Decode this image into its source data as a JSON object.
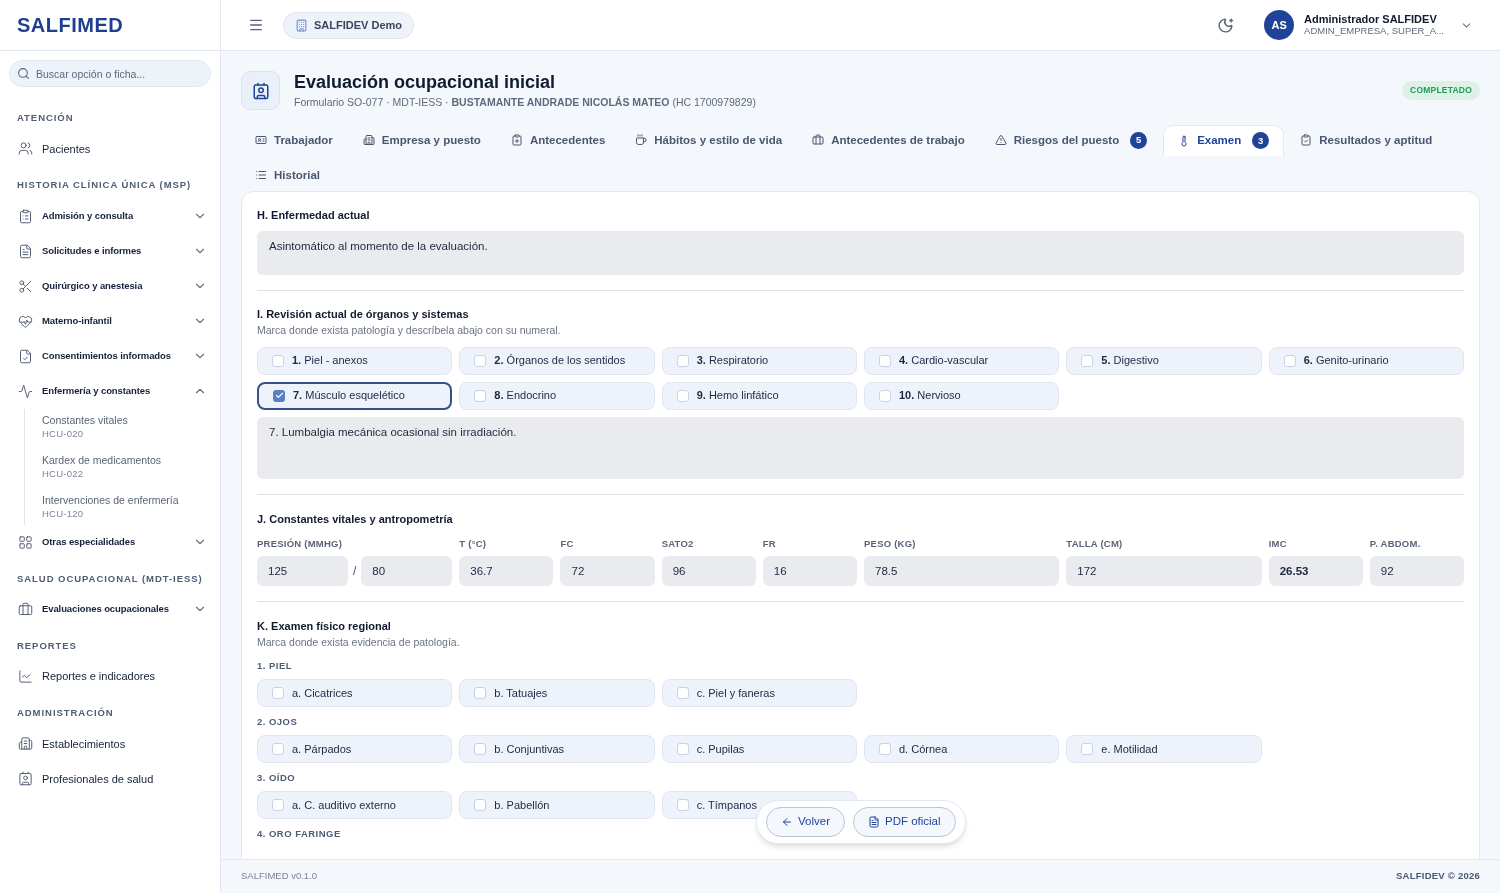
{
  "brand": "SALFIMED",
  "search": {
    "placeholder": "Buscar opción o ficha..."
  },
  "nav": [
    {
      "heading": "ATENCIÓN",
      "items": [
        {
          "label": "Pacientes"
        }
      ]
    },
    {
      "heading": "HISTORIA CLÍNICA ÚNICA (MSP)",
      "items": [
        {
          "label": "Admisión y consulta",
          "expanded": false
        },
        {
          "label": "Solicitudes e informes",
          "expanded": false
        },
        {
          "label": "Quirúrgico y anestesia",
          "expanded": false
        },
        {
          "label": "Materno-infantil",
          "expanded": false
        },
        {
          "label": "Consentimientos informados",
          "expanded": false
        },
        {
          "label": "Enfermería y constantes",
          "expanded": true,
          "children": [
            {
              "label": "Constantes vitales",
              "code": "HCU-020"
            },
            {
              "label": "Kardex de medicamentos",
              "code": "HCU-022"
            },
            {
              "label": "Intervenciones de enfermería",
              "code": "HCU-120"
            }
          ]
        },
        {
          "label": "Otras especialidades",
          "expanded": false
        }
      ]
    },
    {
      "heading": "SALUD OCUPACIONAL (MDT-IESS)",
      "items": [
        {
          "label": "Evaluaciones ocupacionales",
          "expanded": false
        }
      ]
    },
    {
      "heading": "REPORTES",
      "items": [
        {
          "label": "Reportes e indicadores"
        }
      ]
    },
    {
      "heading": "ADMINISTRACIÓN",
      "items": [
        {
          "label": "Establecimientos"
        },
        {
          "label": "Profesionales de salud"
        }
      ]
    }
  ],
  "header": {
    "organization": "SALFIDEV Demo",
    "user": {
      "initials": "AS",
      "name": "Administrador SALFIDEV",
      "roles": "ADMIN_EMPRESA, SUPER_A..."
    }
  },
  "page": {
    "title": "Evaluación ocupacional inicial",
    "subtitle": "Formulario SO-077 · MDT-IESS · **BUSTAMANTE ANDRADE NICOLÁS MATEO** (HC 1700979829)",
    "status": "COMPLETADO"
  },
  "tabs": [
    {
      "label": "Trabajador",
      "selected": false
    },
    {
      "label": "Empresa y puesto",
      "selected": false
    },
    {
      "label": "Antecedentes",
      "selected": false
    },
    {
      "label": "Hábitos y estilo de vida",
      "selected": false
    },
    {
      "label": "Antecedentes de trabajo",
      "selected": false
    },
    {
      "label": "Riesgos del puesto",
      "selected": false,
      "count": "5"
    },
    {
      "label": "Examen",
      "selected": true,
      "count": "3"
    },
    {
      "label": "Resultados y aptitud",
      "selected": false
    },
    {
      "label": "Historial",
      "selected": false
    }
  ],
  "illness": {
    "title": "H. Enfermedad actual",
    "value": "Asintomático al momento de la evaluación."
  },
  "review": {
    "title": "I. Revisión actual de órganos y sistemas",
    "hint": "Marca donde exista patología y descríbela abajo con su numeral.",
    "options": [
      {
        "label": "**1.** Piel - anexos",
        "checked": false
      },
      {
        "label": "**2.** Órganos de los sentidos",
        "checked": false
      },
      {
        "label": "**3.** Respiratorio",
        "checked": false
      },
      {
        "label": "**4.** Cardio-vascular",
        "checked": false
      },
      {
        "label": "**5.** Digestivo",
        "checked": false
      },
      {
        "label": "**6.** Genito-urinario",
        "checked": false
      },
      {
        "label": "**7.** Músculo esquelético",
        "checked": true
      },
      {
        "label": "**8.** Endocrino",
        "checked": false
      },
      {
        "label": "**9.** Hemo linfático",
        "checked": false
      },
      {
        "label": "**10.** Nervioso",
        "checked": false
      }
    ],
    "value": "7. Lumbalgia mecánica ocasional sin irradiación."
  },
  "vitals": {
    "title": "J. Constantes vitales y antropometría",
    "fields": [
      {
        "label": "PRESIÓN (MMHG)",
        "kind": "pair",
        "values": [
          "125",
          "80"
        ],
        "separator": "/"
      },
      {
        "label": "T (°C)",
        "kind": "input",
        "value": "36.7"
      },
      {
        "label": "FC",
        "kind": "input",
        "value": "72"
      },
      {
        "label": "SATO2",
        "kind": "input",
        "value": "96"
      },
      {
        "label": "FR",
        "kind": "input",
        "value": "16"
      },
      {
        "label": "PESO (KG)",
        "kind": "wide",
        "value": "78.5"
      },
      {
        "label": "TALLA (CM)",
        "kind": "wide",
        "value": "172"
      },
      {
        "label": "IMC",
        "kind": "computed",
        "value": "26.53"
      },
      {
        "label": "P. ABDOM.",
        "kind": "input",
        "value": "92"
      }
    ]
  },
  "physical": {
    "title": "K. Examen físico regional",
    "hint": "Marca donde exista evidencia de patología.",
    "groups": [
      {
        "title": "1. PIEL",
        "options": [
          {
            "label": "a. Cicatrices",
            "checked": false
          },
          {
            "label": "b. Tatuajes",
            "checked": false
          },
          {
            "label": "c. Piel y faneras",
            "checked": false
          }
        ]
      },
      {
        "title": "2. OJOS",
        "options": [
          {
            "label": "a. Párpados",
            "checked": false
          },
          {
            "label": "b. Conjuntivas",
            "checked": false
          },
          {
            "label": "c. Pupilas",
            "checked": false
          },
          {
            "label": "d. Córnea",
            "checked": false
          },
          {
            "label": "e. Motilidad",
            "checked": false
          }
        ]
      },
      {
        "title": "3. OÍDO",
        "options": [
          {
            "label": "a. C. auditivo externo",
            "checked": false
          },
          {
            "label": "b. Pabellón",
            "checked": false
          },
          {
            "label": "c. Tímpanos",
            "checked": false
          }
        ]
      },
      {
        "title": "4. ORO FARINGE"
      }
    ]
  },
  "actions": [
    "Volver",
    "PDF oficial"
  ],
  "footer": {
    "left": "SALFIMED v0.1.0",
    "right": "SALFIDEV © 2026"
  }
}
